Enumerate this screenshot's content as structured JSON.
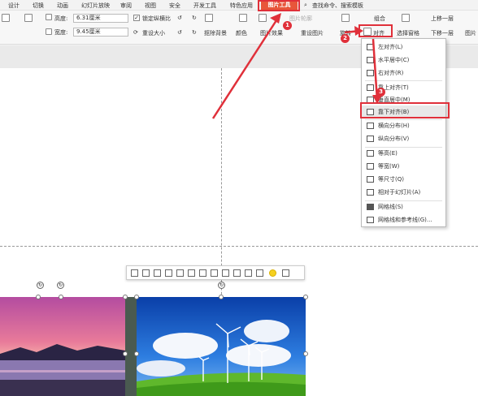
{
  "menu": {
    "items": [
      "设计",
      "切换",
      "动画",
      "幻灯片放映",
      "审阅",
      "视图",
      "安全",
      "开发工具",
      "特色应用"
    ],
    "active_tab": "图片工具",
    "search": "查找命令、搜索模板"
  },
  "toolbar": {
    "height_label": "高度:",
    "height_value": "6.31厘米",
    "width_label": "宽度:",
    "width_value": "9.45厘米",
    "lock_ratio": "锁定纵横比",
    "reset_size": "重设大小",
    "remove_bg": "抠除背景",
    "color": "颜色",
    "pic_effect": "图片效果",
    "pic_outline": "图片轮廓",
    "reset_pic": "重设图片",
    "rotate": "旋转",
    "align": "对齐",
    "group": "组合",
    "select_pane": "选择窗格",
    "bring_forward": "上移一层",
    "send_backward": "下移一层",
    "pic_more": "图片"
  },
  "align_menu": {
    "items": [
      {
        "label": "左对齐(L)",
        "icon": "align-left-icon"
      },
      {
        "label": "水平居中(C)",
        "icon": "align-center-icon"
      },
      {
        "label": "右对齐(R)",
        "icon": "align-right-icon"
      },
      {
        "label": "靠上对齐(T)",
        "icon": "align-top-icon"
      },
      {
        "label": "垂直居中(M)",
        "icon": "align-middle-icon"
      },
      {
        "label": "靠下对齐(B)",
        "icon": "align-bottom-icon"
      },
      {
        "label": "横向分布(H)",
        "icon": "distribute-h-icon"
      },
      {
        "label": "纵向分布(V)",
        "icon": "distribute-v-icon"
      },
      {
        "label": "等高(E)",
        "icon": "same-height-icon"
      },
      {
        "label": "等宽(W)",
        "icon": "same-width-icon"
      },
      {
        "label": "等尺寸(Q)",
        "icon": "same-size-icon"
      },
      {
        "label": "相对于幻灯片(A)",
        "icon": "relative-slide-icon"
      },
      {
        "label": "网格线(S)",
        "icon": "grid-icon"
      },
      {
        "label": "网格线和参考线(G)...",
        "icon": "grid-guides-icon"
      }
    ],
    "highlighted": "靠下对齐(B)"
  },
  "steps": [
    "1",
    "2",
    "3"
  ],
  "colors": {
    "accent": "#e8563a",
    "annotation": "#e0303a"
  }
}
